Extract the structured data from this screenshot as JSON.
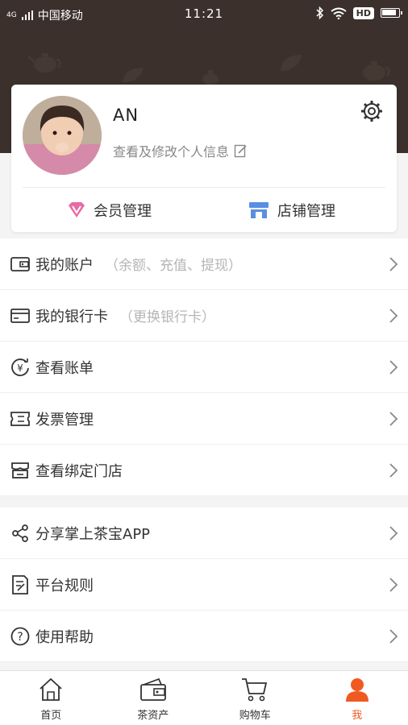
{
  "status": {
    "network": "4G",
    "carrier": "中国移动",
    "time": "11:21",
    "hd": "HD"
  },
  "profile": {
    "name": "AN",
    "subtitle": "查看及修改个人信息"
  },
  "card_actions": [
    {
      "label": "会员管理",
      "icon": "v-badge-icon"
    },
    {
      "label": "店铺管理",
      "icon": "store-icon"
    }
  ],
  "menu_group_1": [
    {
      "label": "我的账户",
      "hint": "（余额、充值、提现）",
      "icon": "wallet-icon"
    },
    {
      "label": "我的银行卡",
      "hint": "（更换银行卡）",
      "icon": "card-icon"
    },
    {
      "label": "查看账单",
      "hint": "",
      "icon": "yen-cycle-icon"
    },
    {
      "label": "发票管理",
      "hint": "",
      "icon": "ticket-icon"
    },
    {
      "label": "查看绑定门店",
      "hint": "",
      "icon": "shop-icon"
    }
  ],
  "menu_group_2": [
    {
      "label": "分享掌上茶宝APP",
      "icon": "share-icon"
    },
    {
      "label": "平台规则",
      "icon": "rules-icon"
    },
    {
      "label": "使用帮助",
      "icon": "help-icon"
    }
  ],
  "tabs": [
    {
      "label": "首页",
      "icon": "home-icon"
    },
    {
      "label": "茶资产",
      "icon": "wallet-icon"
    },
    {
      "label": "购物车",
      "icon": "cart-icon"
    },
    {
      "label": "我",
      "icon": "person-icon",
      "active": true
    }
  ],
  "colors": {
    "header": "#3b302b",
    "accent": "#f05a22",
    "member_icon": "#e86aa6",
    "store_icon": "#5a8fe0"
  }
}
